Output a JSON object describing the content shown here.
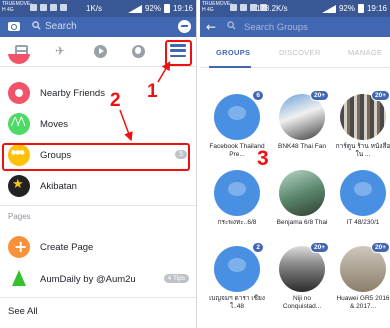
{
  "left": {
    "status": {
      "carrier": "TRUEMOVE-H 4G",
      "speed": "1K/s",
      "battery": "92%",
      "time": "19:16"
    },
    "search": {
      "placeholder": "Search"
    },
    "menu_items": [
      {
        "label": "Nearby Friends",
        "icon": "nearby-icon"
      },
      {
        "label": "Moves",
        "icon": "moves-icon"
      },
      {
        "label": "Groups",
        "icon": "groups-icon",
        "badge": "5"
      },
      {
        "label": "Akibatan",
        "icon": "akibatan-icon"
      }
    ],
    "pages_section": "Pages",
    "page_items": [
      {
        "label": "Create Page",
        "icon": "create-page-icon"
      },
      {
        "label": "AumDaily by @Aum2u",
        "icon": "aumdaily-icon",
        "badge": "4 Tips"
      }
    ],
    "see_all": "See All",
    "annotations": {
      "one": "1",
      "two": "2"
    }
  },
  "right": {
    "status": {
      "carrier": "TRUEMOVE-H 4G",
      "speed": "178.2K/s",
      "battery": "92%",
      "time": "19:16"
    },
    "search": {
      "placeholder": "Search Groups"
    },
    "tabs": [
      "GROUPS",
      "DISCOVER",
      "MANAGE"
    ],
    "annotation": "3",
    "groups": [
      {
        "name": "Facebook Thailand Pre...",
        "badge": "6",
        "style": "default"
      },
      {
        "name": "BNK48 Thai Fan",
        "badge": "20+",
        "style": "c-photo1"
      },
      {
        "name": "การ์ตูน ร้าน หนังสือใน ...",
        "badge": "20+",
        "style": "c-photo3"
      },
      {
        "name": "กระพงทะ..6/8",
        "badge": "",
        "style": "default"
      },
      {
        "name": "Benjama 6/8 Thai",
        "badge": "",
        "style": "c-photo4"
      },
      {
        "name": "IT 48/230/1",
        "badge": "",
        "style": "default"
      },
      {
        "name": "เบญจมฯ ดารา เชียงใ..48",
        "badge": "2",
        "style": "default"
      },
      {
        "name": "Niji no Conquistad...",
        "badge": "20+",
        "style": "c-photo5"
      },
      {
        "name": "Huawei GR5 2016 & 2017...",
        "badge": "20+",
        "style": "c-photo6"
      }
    ]
  }
}
